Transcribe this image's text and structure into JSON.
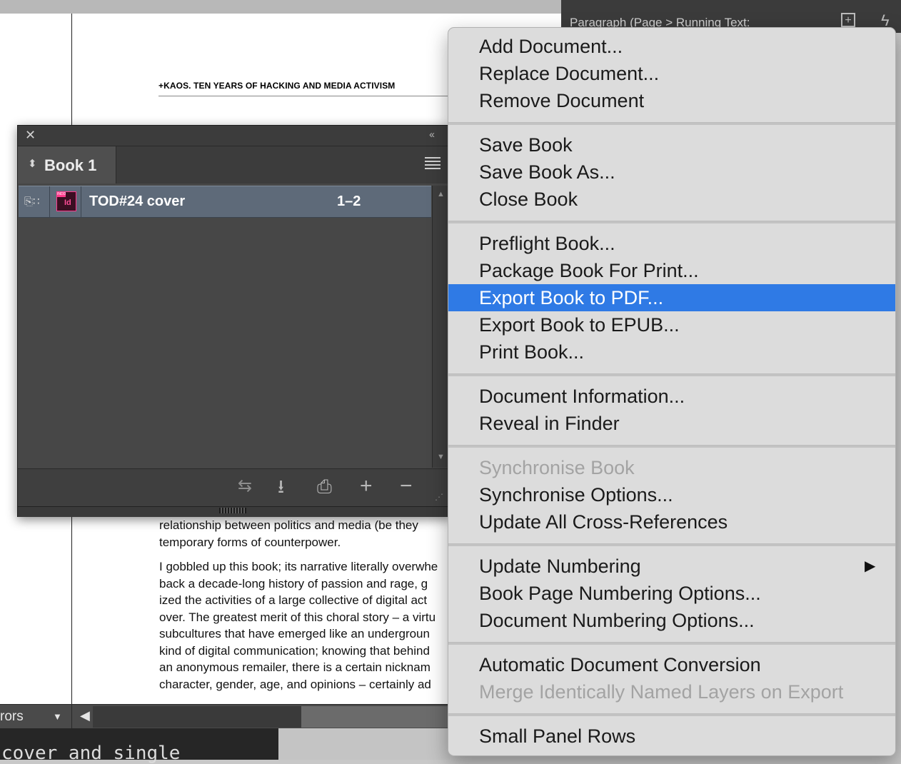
{
  "document_page": {
    "running_head": "+KAOS. TEN YEARS OF HACKING AND MEDIA ACTIVISM",
    "body_lines": [
      "relationship between politics and media (be they",
      "temporary forms of counterpower.",
      "I gobbled up this book; its narrative literally overwhe",
      "back a decade-long history of passion and rage, g",
      "ized the activities of a large collective of digital act",
      "over. The greatest merit of this choral story – a virtu",
      "subcultures that have emerged like an undergroun",
      "kind of digital communication; knowing that behind",
      "an anonymous remailer, there is a certain nicknam",
      "character, gender, age, and opinions – certainly ad"
    ]
  },
  "paragraph_panel": {
    "title": "Paragraph (Page > Running Text:",
    "icons": [
      "add-style-icon",
      "lightning-icon"
    ]
  },
  "status_bar": {
    "errors_label": "rors",
    "dropdown_icon": "chevron-down-icon",
    "scroll_left_icon": "triangle-left-icon",
    "code_text": "cover and single"
  },
  "book_panel": {
    "tab_label": "Book 1",
    "documents": [
      {
        "name": "TOD#24 cover",
        "pages": "1–2",
        "icon": "indesign-doc-icon",
        "icon_letters": "Id",
        "icon_tag": "INDD"
      }
    ],
    "footer_icons": [
      "synchronize-icon",
      "save-book-icon",
      "print-book-icon",
      "add-document-icon",
      "remove-document-icon"
    ],
    "glyphs": {
      "close": "✕",
      "collapse": "‹‹",
      "sort": "⬍",
      "status": "⎘∷",
      "scroll_up": "▲",
      "scroll_down": "▼",
      "sync": "⇆",
      "save": "⭳",
      "print": "⎙",
      "add": "+",
      "remove": "−",
      "grip": "⋰",
      "dropdown": "▼",
      "scroll_left": "◀",
      "add_style": "+",
      "bolt": "ϟ",
      "submenu": "▶"
    }
  },
  "colors": {
    "menu_highlight": "#2f7ae5",
    "indesign_pink": "#ff3a8c",
    "selected_row": "#5e6a79"
  },
  "menu": {
    "groups": [
      {
        "items": [
          {
            "label": "Add Document...",
            "enabled": true
          },
          {
            "label": "Replace Document...",
            "enabled": true
          },
          {
            "label": "Remove Document",
            "enabled": true
          }
        ]
      },
      {
        "items": [
          {
            "label": "Save Book",
            "enabled": true
          },
          {
            "label": "Save Book As...",
            "enabled": true
          },
          {
            "label": "Close Book",
            "enabled": true
          }
        ]
      },
      {
        "items": [
          {
            "label": "Preflight Book...",
            "enabled": true
          },
          {
            "label": "Package Book For Print...",
            "enabled": true
          },
          {
            "label": "Export Book to PDF...",
            "enabled": true,
            "highlighted": true
          },
          {
            "label": "Export Book to EPUB...",
            "enabled": true
          },
          {
            "label": "Print Book...",
            "enabled": true
          }
        ]
      },
      {
        "items": [
          {
            "label": "Document Information...",
            "enabled": true
          },
          {
            "label": "Reveal in Finder",
            "enabled": true
          }
        ]
      },
      {
        "items": [
          {
            "label": "Synchronise Book",
            "enabled": false
          },
          {
            "label": "Synchronise Options...",
            "enabled": true
          },
          {
            "label": "Update All Cross-References",
            "enabled": true
          }
        ]
      },
      {
        "items": [
          {
            "label": "Update Numbering",
            "enabled": true,
            "submenu": true
          },
          {
            "label": "Book Page Numbering Options...",
            "enabled": true
          },
          {
            "label": "Document Numbering Options...",
            "enabled": true
          }
        ]
      },
      {
        "items": [
          {
            "label": "Automatic Document Conversion",
            "enabled": true
          },
          {
            "label": "Merge Identically Named Layers on Export",
            "enabled": false
          }
        ]
      },
      {
        "items": [
          {
            "label": "Small Panel Rows",
            "enabled": true
          }
        ]
      }
    ]
  }
}
